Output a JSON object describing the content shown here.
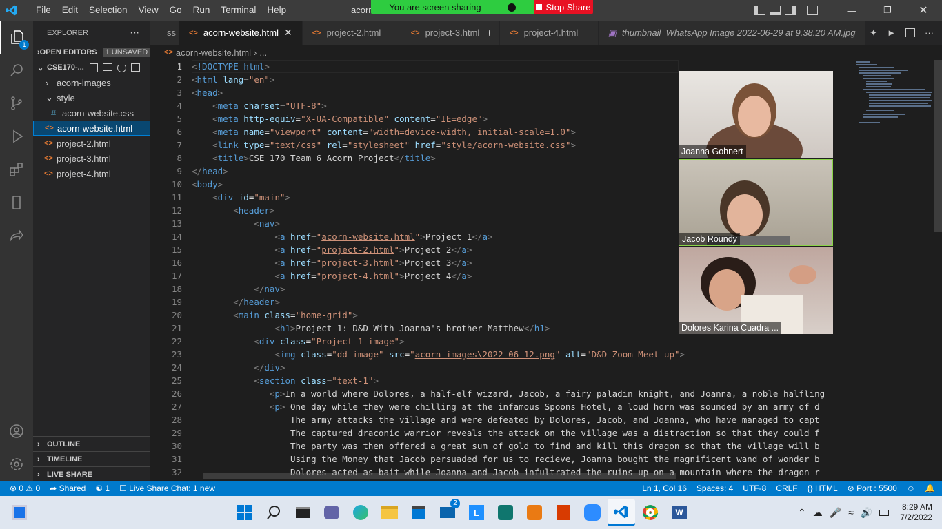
{
  "titlebar": {
    "menu": [
      "File",
      "Edit",
      "Selection",
      "View",
      "Go",
      "Run",
      "Terminal",
      "Help"
    ],
    "title_fragment": "acorn",
    "sharing_text": "You are screen sharing",
    "stop_label": "Stop Share"
  },
  "explorer": {
    "title": "EXPLORER",
    "open_editors": "OPEN EDITORS",
    "unsaved": "1 UNSAVED",
    "folder": "CSE170-...",
    "items": [
      "acorn-images",
      "style",
      "acorn-website.css",
      "acorn-website.html",
      "project-2.html",
      "project-3.html",
      "project-4.html"
    ],
    "outline": "OUTLINE",
    "timeline": "TIMELINE",
    "liveshare": "LIVE SHARE"
  },
  "tabs": [
    {
      "label": "ss"
    },
    {
      "label": "acorn-website.html"
    },
    {
      "label": "project-2.html"
    },
    {
      "label": "project-3.html"
    },
    {
      "label": "project-4.html"
    },
    {
      "label": "thumbnail_WhatsApp Image 2022-06-29 at 9.38.20 AM.jpg"
    }
  ],
  "breadcrumb": {
    "file": "acorn-website.html",
    "rest": "..."
  },
  "code_lines": [
    "<!DOCTYPE html>",
    "<html lang=\"en\">",
    "<head>",
    "    <meta charset=\"UTF-8\">",
    "    <meta http-equiv=\"X-UA-Compatible\" content=\"IE=edge\">",
    "    <meta name=\"viewport\" content=\"width=device-width, initial-scale=1.0\">",
    "    <link type=\"text/css\" rel=\"stylesheet\" href=\"style/acorn-website.css\">",
    "    <title>CSE 170 Team 6 Acorn Project</title>",
    "</head>",
    "<body>",
    "    <div id=\"main\">",
    "        <header>",
    "            <nav>",
    "                <a href=\"acorn-website.html\">Project 1</a>",
    "                <a href=\"project-2.html\">Project 2</a>",
    "                <a href=\"project-3.html\">Project 3</a>",
    "                <a href=\"project-4.html\">Project 4</a>",
    "            </nav>",
    "        </header>",
    "        <main class=\"home-grid\">",
    "                <h1>Project 1: D&D With Joanna's brother Matthew</h1>",
    "            <div class=\"Project-1-image\">",
    "                <img class=\"dd-image\" src=\"acorn-images\\2022-06-12.png\" alt=\"D&D Zoom Meet up\">",
    "            </div>",
    "            <section class=\"text-1\">",
    "               <p>In a world where Dolores, a half-elf wizard, Jacob, a fairy paladin knight, and Joanna, a noble halfling",
    "               <p> One day while they were chilling at the infamous Spoons Hotel, a loud horn was sounded by an army of d",
    "                   The army attacks the village and were defeated by Dolores, Jacob, and Joanna, who have managed to capt",
    "                   The captured draconic warrior reveals the attack on the village was a distraction so that they could f",
    "                   The party was then offered a great sum of gold to find and kill this dragon so that the village will b",
    "                   Using the Money that Jacob persuaded for us to recieve, Joanna bought the magnificent wand of wonder b",
    "                   Dolores acted as bait while Joanna and Jacob infultrated the ruins up on a mountain where the dragon r"
  ],
  "participants": [
    {
      "name": "Joanna Gohnert"
    },
    {
      "name": "Jacob Roundy"
    },
    {
      "name": "Dolores Karina Cuadra ..."
    }
  ],
  "status": {
    "errors": "0",
    "warnings": "0",
    "shared": "Shared",
    "followers": "1",
    "chat": "Live Share Chat: 1 new",
    "position": "Ln 1, Col 16",
    "spaces": "Spaces: 4",
    "encoding": "UTF-8",
    "eol": "CRLF",
    "language": "HTML",
    "port": "Port : 5500"
  },
  "taskbar": {
    "time": "8:29 AM",
    "date": "7/2/2022",
    "badge": "2"
  }
}
